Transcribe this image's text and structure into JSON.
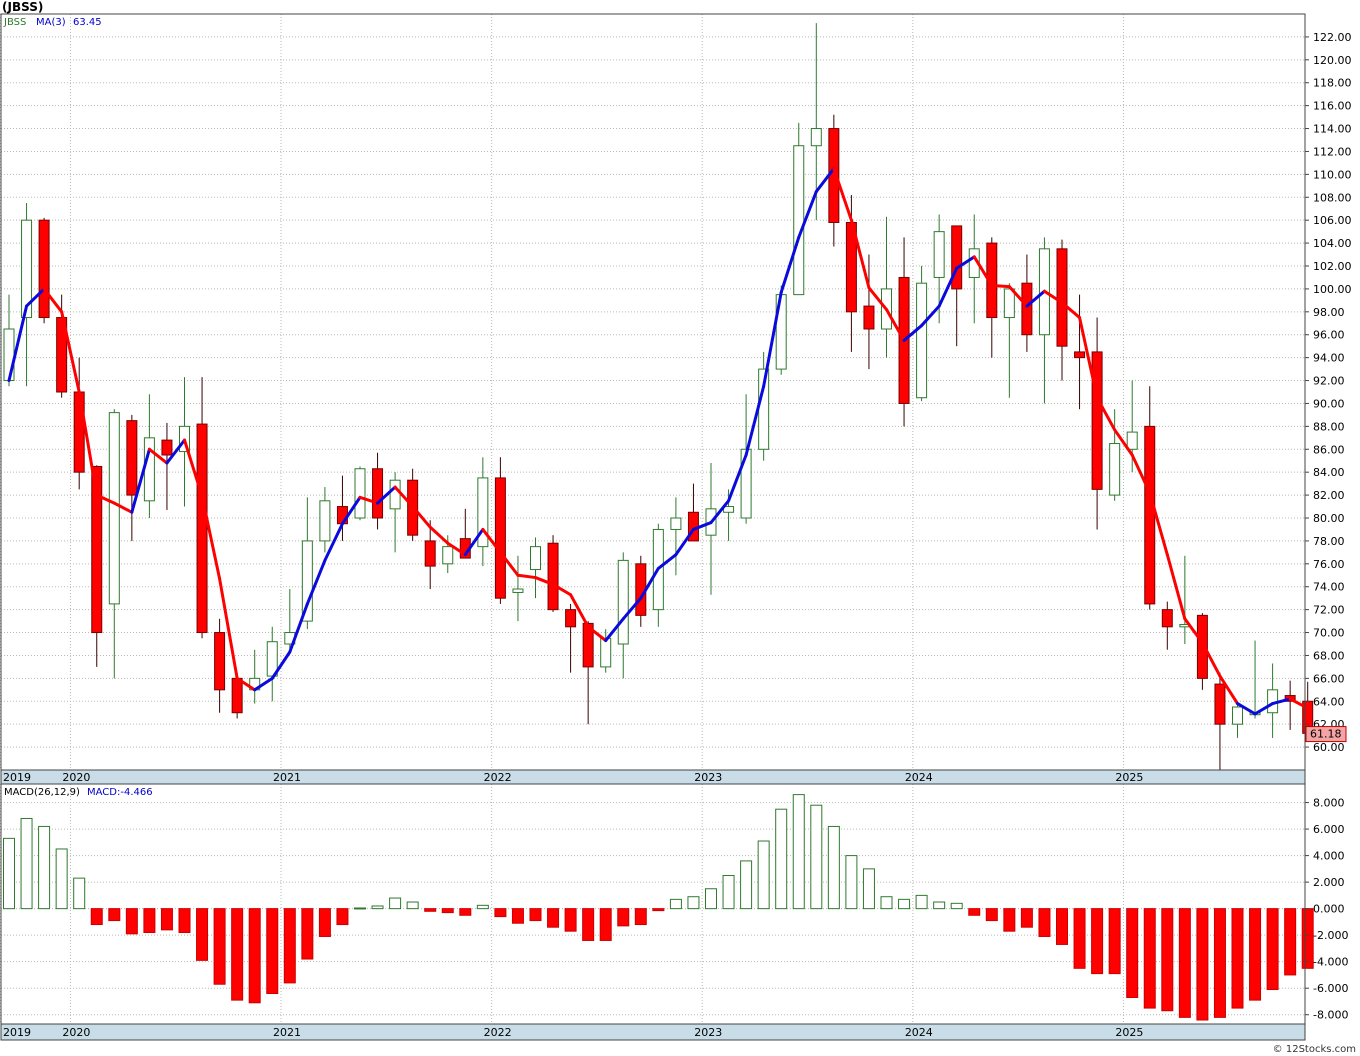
{
  "chart_data": [
    {
      "type": "candlestick",
      "symbol_label": "(JBSS)",
      "ticker": "JBSS",
      "ma_label": "MA(3)",
      "ma_value": "63.45",
      "last_price_label": "61.18",
      "ylim": [
        58,
        124
      ],
      "y_ticks": [
        "60.00",
        "62.00",
        "64.00",
        "66.00",
        "68.00",
        "70.00",
        "72.00",
        "74.00",
        "76.00",
        "78.00",
        "80.00",
        "82.00",
        "84.00",
        "86.00",
        "88.00",
        "90.00",
        "92.00",
        "94.00",
        "96.00",
        "98.00",
        "100.00",
        "102.00",
        "104.00",
        "106.00",
        "108.00",
        "110.00",
        "112.00",
        "114.00",
        "116.00",
        "118.00",
        "120.00",
        "122.00"
      ],
      "year_labels": [
        {
          "label": "2019",
          "month_index": 0
        },
        {
          "label": "2020",
          "month_index": 4
        },
        {
          "label": "2021",
          "month_index": 16
        },
        {
          "label": "2022",
          "month_index": 28
        },
        {
          "label": "2023",
          "month_index": 40
        },
        {
          "label": "2024",
          "month_index": 52
        },
        {
          "label": "2025",
          "month_index": 64
        }
      ],
      "candles": [
        {
          "o": 92.0,
          "h": 99.5,
          "l": 91.5,
          "c": 96.5
        },
        {
          "o": 97.5,
          "h": 107.5,
          "l": 91.5,
          "c": 106.0
        },
        {
          "o": 106.0,
          "h": 106.2,
          "l": 97.0,
          "c": 97.5
        },
        {
          "o": 97.5,
          "h": 99.5,
          "l": 90.5,
          "c": 91.0
        },
        {
          "o": 91.0,
          "h": 94.0,
          "l": 82.5,
          "c": 84.0
        },
        {
          "o": 84.5,
          "h": 84.6,
          "l": 67.0,
          "c": 70.0
        },
        {
          "o": 72.5,
          "h": 89.5,
          "l": 66.0,
          "c": 89.2
        },
        {
          "o": 88.5,
          "h": 89.0,
          "l": 78.0,
          "c": 82.0
        },
        {
          "o": 81.5,
          "h": 90.8,
          "l": 80.0,
          "c": 87.0
        },
        {
          "o": 86.8,
          "h": 88.3,
          "l": 80.7,
          "c": 85.5
        },
        {
          "o": 85.8,
          "h": 92.3,
          "l": 81.0,
          "c": 88.0
        },
        {
          "o": 88.2,
          "h": 92.3,
          "l": 69.5,
          "c": 70.0
        },
        {
          "o": 70.0,
          "h": 71.2,
          "l": 63.0,
          "c": 65.0
        },
        {
          "o": 66.0,
          "h": 66.5,
          "l": 62.5,
          "c": 63.0
        },
        {
          "o": 65.0,
          "h": 68.5,
          "l": 63.8,
          "c": 66.0
        },
        {
          "o": 66.2,
          "h": 70.5,
          "l": 64.0,
          "c": 69.2
        },
        {
          "o": 69.0,
          "h": 73.8,
          "l": 68.5,
          "c": 70.0
        },
        {
          "o": 71.0,
          "h": 81.8,
          "l": 70.3,
          "c": 78.0
        },
        {
          "o": 78.0,
          "h": 82.7,
          "l": 77.0,
          "c": 81.5
        },
        {
          "o": 81.0,
          "h": 83.7,
          "l": 78.0,
          "c": 79.5
        },
        {
          "o": 80.0,
          "h": 84.5,
          "l": 79.8,
          "c": 84.3
        },
        {
          "o": 84.3,
          "h": 85.7,
          "l": 79.0,
          "c": 80.0
        },
        {
          "o": 80.8,
          "h": 84.0,
          "l": 77.0,
          "c": 83.3
        },
        {
          "o": 83.3,
          "h": 84.3,
          "l": 78.0,
          "c": 78.5
        },
        {
          "o": 78.0,
          "h": 79.8,
          "l": 73.8,
          "c": 75.8
        },
        {
          "o": 76.0,
          "h": 78.5,
          "l": 75.2,
          "c": 77.5
        },
        {
          "o": 78.2,
          "h": 80.8,
          "l": 76.5,
          "c": 76.5
        },
        {
          "o": 77.5,
          "h": 85.3,
          "l": 75.8,
          "c": 83.5
        },
        {
          "o": 83.5,
          "h": 85.3,
          "l": 72.5,
          "c": 73.0
        },
        {
          "o": 73.5,
          "h": 76.7,
          "l": 71.0,
          "c": 73.8
        },
        {
          "o": 75.5,
          "h": 78.3,
          "l": 73.0,
          "c": 77.5
        },
        {
          "o": 77.8,
          "h": 78.5,
          "l": 71.8,
          "c": 72.0
        },
        {
          "o": 72.0,
          "h": 72.5,
          "l": 66.5,
          "c": 70.5
        },
        {
          "o": 70.8,
          "h": 71.0,
          "l": 62.0,
          "c": 67.0
        },
        {
          "o": 67.0,
          "h": 70.3,
          "l": 66.5,
          "c": 69.5
        },
        {
          "o": 69.0,
          "h": 77.0,
          "l": 66.0,
          "c": 76.3
        },
        {
          "o": 76.0,
          "h": 76.7,
          "l": 70.5,
          "c": 71.5
        },
        {
          "o": 72.0,
          "h": 79.5,
          "l": 70.5,
          "c": 79.0
        },
        {
          "o": 79.0,
          "h": 81.8,
          "l": 75.0,
          "c": 80.0
        },
        {
          "o": 80.5,
          "h": 83.0,
          "l": 78.5,
          "c": 78.0
        },
        {
          "o": 78.5,
          "h": 84.8,
          "l": 73.3,
          "c": 80.8
        },
        {
          "o": 80.5,
          "h": 82.5,
          "l": 78.0,
          "c": 81.0
        },
        {
          "o": 80.0,
          "h": 90.8,
          "l": 79.5,
          "c": 86.0
        },
        {
          "o": 86.0,
          "h": 94.5,
          "l": 85.0,
          "c": 93.0
        },
        {
          "o": 93.0,
          "h": 100.3,
          "l": 92.5,
          "c": 99.5
        },
        {
          "o": 99.5,
          "h": 114.5,
          "l": 99.5,
          "c": 112.5
        },
        {
          "o": 112.5,
          "h": 123.2,
          "l": 106.0,
          "c": 114.0
        },
        {
          "o": 114.0,
          "h": 115.2,
          "l": 103.7,
          "c": 105.8
        },
        {
          "o": 105.8,
          "h": 108.2,
          "l": 94.5,
          "c": 98.0
        },
        {
          "o": 98.5,
          "h": 103.0,
          "l": 93.0,
          "c": 96.5
        },
        {
          "o": 96.5,
          "h": 106.3,
          "l": 94.0,
          "c": 100.0
        },
        {
          "o": 101.0,
          "h": 104.5,
          "l": 88.0,
          "c": 90.0
        },
        {
          "o": 90.5,
          "h": 102.0,
          "l": 90.2,
          "c": 100.5
        },
        {
          "o": 101.0,
          "h": 106.5,
          "l": 97.0,
          "c": 105.0
        },
        {
          "o": 105.5,
          "h": 105.5,
          "l": 95.0,
          "c": 100.0
        },
        {
          "o": 101.0,
          "h": 106.5,
          "l": 97.0,
          "c": 103.5
        },
        {
          "o": 104.0,
          "h": 104.5,
          "l": 94.0,
          "c": 97.5
        },
        {
          "o": 97.5,
          "h": 100.5,
          "l": 90.5,
          "c": 100.0
        },
        {
          "o": 100.5,
          "h": 103.0,
          "l": 94.5,
          "c": 96.0
        },
        {
          "o": 96.0,
          "h": 104.5,
          "l": 90.0,
          "c": 103.5
        },
        {
          "o": 103.5,
          "h": 104.3,
          "l": 92.0,
          "c": 95.0
        },
        {
          "o": 94.5,
          "h": 99.5,
          "l": 89.5,
          "c": 94.0
        },
        {
          "o": 94.5,
          "h": 97.5,
          "l": 79.0,
          "c": 82.5
        },
        {
          "o": 82.0,
          "h": 89.5,
          "l": 81.5,
          "c": 86.5
        },
        {
          "o": 86.0,
          "h": 92.0,
          "l": 84.0,
          "c": 87.5
        },
        {
          "o": 88.0,
          "h": 91.5,
          "l": 72.0,
          "c": 72.5
        },
        {
          "o": 72.0,
          "h": 72.7,
          "l": 68.5,
          "c": 70.5
        },
        {
          "o": 70.5,
          "h": 76.7,
          "l": 69.0,
          "c": 70.7
        },
        {
          "o": 71.5,
          "h": 71.7,
          "l": 65.0,
          "c": 66.0
        },
        {
          "o": 65.5,
          "h": 66.5,
          "l": 58.0,
          "c": 62.0
        },
        {
          "o": 62.0,
          "h": 64.0,
          "l": 60.8,
          "c": 63.5
        },
        {
          "o": 63.0,
          "h": 69.3,
          "l": 62.5,
          "c": 63.0
        },
        {
          "o": 63.0,
          "h": 67.3,
          "l": 60.8,
          "c": 65.0
        },
        {
          "o": 64.5,
          "h": 65.8,
          "l": 61.5,
          "c": 64.0
        },
        {
          "o": 64.0,
          "h": 65.7,
          "l": 60.8,
          "c": 61.2
        }
      ],
      "ma3": [
        92.0,
        98.5,
        100.0,
        98.0,
        91.0,
        82.0,
        81.3,
        80.5,
        86.0,
        84.8,
        86.8,
        81.9,
        74.7,
        66.0,
        65.0,
        66.0,
        68.3,
        72.5,
        76.3,
        79.5,
        81.8,
        81.3,
        82.7,
        81.0,
        79.2,
        77.8,
        76.8,
        79.0,
        77.0,
        75.0,
        74.8,
        74.2,
        73.3,
        70.5,
        69.3,
        71.2,
        73.0,
        75.6,
        76.8,
        79.0,
        79.6,
        81.5,
        85.5,
        91.5,
        99.7,
        104.5,
        108.5,
        110.5,
        106.0,
        100.1,
        98.2,
        95.5,
        96.8,
        98.5,
        101.8,
        102.8,
        100.3,
        100.2,
        98.5,
        99.8,
        98.8,
        97.5,
        90.5,
        87.7,
        85.5,
        82.2,
        76.8,
        71.2,
        69.1,
        66.2,
        63.8,
        62.9,
        63.8,
        64.2,
        63.4
      ],
      "ma3_up": [
        true,
        true,
        true,
        false,
        false,
        false,
        false,
        false,
        true,
        false,
        true,
        false,
        false,
        false,
        false,
        true,
        true,
        true,
        true,
        true,
        true,
        false,
        true,
        false,
        false,
        false,
        false,
        true,
        false,
        false,
        false,
        false,
        false,
        false,
        false,
        true,
        true,
        true,
        true,
        true,
        true,
        true,
        true,
        true,
        true,
        true,
        true,
        true,
        false,
        false,
        false,
        false,
        true,
        true,
        true,
        true,
        false,
        false,
        false,
        true,
        false,
        false,
        false,
        false,
        false,
        false,
        false,
        false,
        false,
        false,
        false,
        true,
        true,
        true,
        false
      ]
    },
    {
      "type": "bar",
      "title": "MACD(26,12,9)",
      "value_label": "MACD:-4.466",
      "ylim": [
        -8.7,
        9.4
      ],
      "y_ticks": [
        "-8.000",
        "-6.000",
        "-4.000",
        "-2.000",
        "0.000",
        "2.000",
        "4.000",
        "6.000",
        "8.000"
      ],
      "year_labels": [
        {
          "label": "2019",
          "month_index": 0
        },
        {
          "label": "2020",
          "month_index": 4
        },
        {
          "label": "2021",
          "month_index": 16
        },
        {
          "label": "2022",
          "month_index": 28
        },
        {
          "label": "2023",
          "month_index": 40
        },
        {
          "label": "2024",
          "month_index": 52
        },
        {
          "label": "2025",
          "month_index": 64
        }
      ],
      "values": [
        5.3,
        6.8,
        6.2,
        4.5,
        2.3,
        -1.2,
        -0.9,
        -1.9,
        -1.8,
        -1.6,
        -1.8,
        -3.9,
        -5.7,
        -6.9,
        -7.1,
        -6.4,
        -5.6,
        -3.8,
        -2.1,
        -1.2,
        0.05,
        0.2,
        0.8,
        0.5,
        -0.2,
        -0.3,
        -0.5,
        0.25,
        -0.6,
        -1.1,
        -0.9,
        -1.4,
        -1.7,
        -2.4,
        -2.4,
        -1.3,
        -1.2,
        -0.15,
        0.7,
        0.9,
        1.5,
        2.5,
        3.6,
        5.1,
        7.5,
        8.6,
        7.8,
        6.2,
        4.0,
        3.0,
        0.9,
        0.7,
        1.0,
        0.5,
        0.4,
        -0.5,
        -0.9,
        -1.7,
        -1.4,
        -2.1,
        -2.7,
        -4.5,
        -4.9,
        -4.9,
        -6.7,
        -7.5,
        -7.7,
        -8.2,
        -8.4,
        -8.2,
        -7.5,
        -6.9,
        -6.1,
        -5.0,
        -4.5
      ]
    }
  ],
  "footer": {
    "copyright": "© 12Stocks.com"
  }
}
